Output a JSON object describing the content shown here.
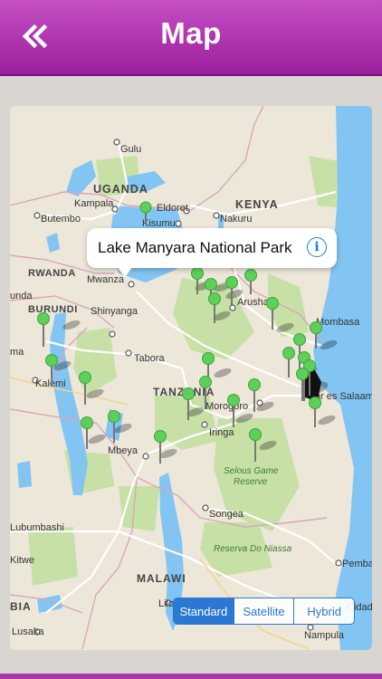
{
  "header": {
    "title": "Map",
    "back_icon": "double-chevron-left-icon",
    "gradient_top": "#c54fc4",
    "gradient_bottom": "#9b1f9d"
  },
  "map": {
    "country_labels": [
      "UGANDA",
      "KENYA",
      "RWANDA",
      "BURUNDI",
      "TANZANIA",
      "MALAWI",
      "BIA"
    ],
    "city_labels": [
      "Gulu",
      "Kampala",
      "Eldoret",
      "Butembo",
      "Nakuru",
      "Kisumu",
      "Mwanza",
      "Arusha",
      "Shinyanga",
      "Tabora",
      "Morogoro",
      "Iringa",
      "Mbeya",
      "Songea",
      "Mombasa",
      "Dar es Salaam",
      "Kalemi",
      "Lilongwe",
      "Lusaka",
      "Nampula",
      "Pemba",
      "Kitwe",
      "Lubumbashi",
      "Cidade",
      "unda",
      "ma"
    ],
    "park_labels": [
      "Selous Game Reserve",
      "Reserva Do Niassa"
    ],
    "land_color": "#ede7da",
    "water_color": "#82c4f2",
    "park_color": "#c7e0a6",
    "pin_color": "#5ed05a"
  },
  "callout": {
    "title": "Lake Manyara National Park",
    "info_icon": "info-circle-icon"
  },
  "map_type": {
    "options": [
      "Standard",
      "Satellite",
      "Hybrid"
    ],
    "selected": "Standard"
  }
}
